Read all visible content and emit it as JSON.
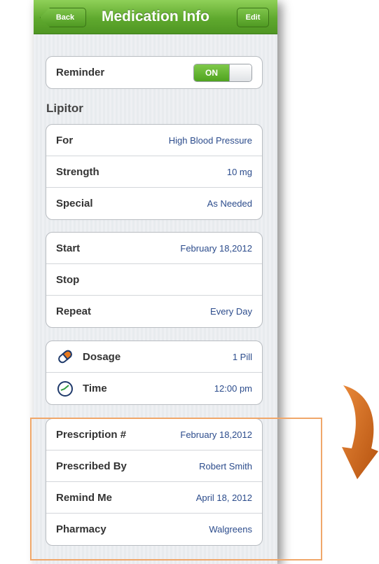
{
  "nav": {
    "back": "Back",
    "title": "Medication Info",
    "edit": "Edit"
  },
  "reminder": {
    "label": "Reminder",
    "toggle": "ON"
  },
  "medication_name": "Lipitor",
  "details": [
    {
      "label": "For",
      "value": "High Blood Pressure"
    },
    {
      "label": "Strength",
      "value": "10 mg"
    },
    {
      "label": "Special",
      "value": "As Needed"
    }
  ],
  "schedule": [
    {
      "label": "Start",
      "value": "February 18,2012"
    },
    {
      "label": "Stop",
      "value": ""
    },
    {
      "label": "Repeat",
      "value": "Every Day"
    }
  ],
  "dosing": [
    {
      "label": "Dosage",
      "value": "1 Pill",
      "icon": "pill-icon"
    },
    {
      "label": "Time",
      "value": "12:00 pm",
      "icon": "clock-icon"
    }
  ],
  "prescription": [
    {
      "label": "Prescription #",
      "value": "February 18,2012"
    },
    {
      "label": "Prescribed By",
      "value": "Robert Smith"
    },
    {
      "label": "Remind Me",
      "value": "April 18, 2012"
    },
    {
      "label": "Pharmacy",
      "value": "Walgreens"
    }
  ],
  "colors": {
    "nav_green": "#5fa92e",
    "value_blue": "#2c4c8c",
    "highlight": "#f0a76a",
    "arrow": "#c9631a"
  }
}
